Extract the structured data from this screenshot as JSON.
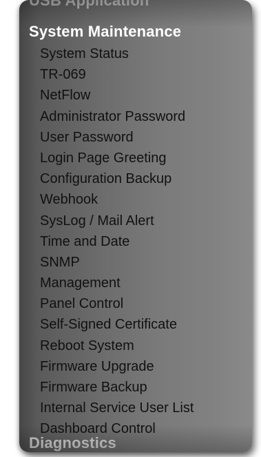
{
  "menu": {
    "previous_section": "USB Application",
    "section_title": "System Maintenance",
    "items": [
      "System Status",
      "TR-069",
      "NetFlow",
      "Administrator Password",
      "User Password",
      "Login Page Greeting",
      "Configuration Backup",
      "Webhook",
      "SysLog / Mail Alert",
      "Time and Date",
      "SNMP",
      "Management",
      "Panel Control",
      "Self-Signed Certificate",
      "Reboot System",
      "Firmware Upgrade",
      "Firmware Backup",
      "Internal Service User List",
      "Dashboard Control"
    ],
    "next_section": "Diagnostics"
  }
}
